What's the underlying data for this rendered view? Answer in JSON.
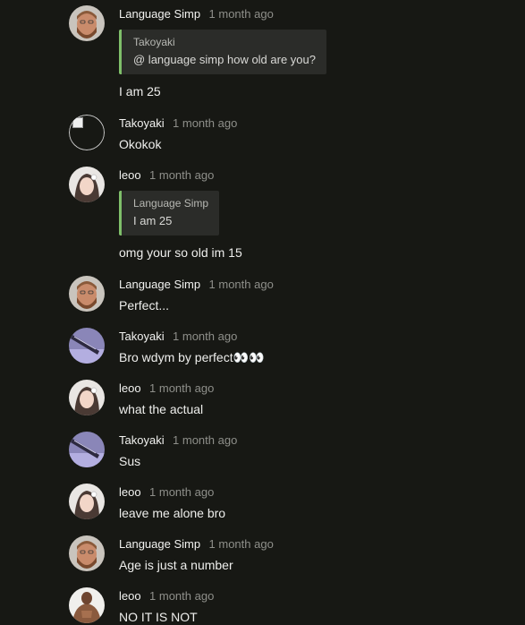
{
  "comments": [
    {
      "author": "Language Simp",
      "time": "1 month ago",
      "quote_author": "Takoyaki",
      "quote_text": "@ language simp how old are you?",
      "text": "I am 25",
      "avatar": "man-beard-avatar"
    },
    {
      "author": "Takoyaki",
      "time": "1 month ago",
      "text": "Okokok",
      "avatar": "broken-image-avatar"
    },
    {
      "author": "leoo",
      "time": "1 month ago",
      "quote_author": "Language Simp",
      "quote_text": "I am 25",
      "text": "omg your so old im 15",
      "avatar": "girl-avatar"
    },
    {
      "author": "Language Simp",
      "time": "1 month ago",
      "text": "Perfect...",
      "avatar": "man-beard-avatar"
    },
    {
      "author": "Takoyaki",
      "time": "1 month ago",
      "text": "Bro wdym by perfect👀👀",
      "avatar": "purple-pen-avatar"
    },
    {
      "author": "leoo",
      "time": "1 month ago",
      "text": "what the actual",
      "avatar": "girl-avatar"
    },
    {
      "author": "Takoyaki",
      "time": "1 month ago",
      "text": "Sus",
      "avatar": "purple-pen-avatar"
    },
    {
      "author": "leoo",
      "time": "1 month ago",
      "text": "leave me alone bro",
      "avatar": "girl-avatar"
    },
    {
      "author": "Language Simp",
      "time": "1 month ago",
      "text": "Age is just a number",
      "avatar": "man-beard-avatar"
    },
    {
      "author": "leoo",
      "time": "1 month ago",
      "text": "NO IT IS NOT",
      "avatar": "muscle-man-avatar"
    }
  ],
  "colors": {
    "background": "#171814",
    "quote_bar": "#7fbf6a",
    "quote_bg": "#2b2c29",
    "timestamp": "#8e8f8a"
  }
}
